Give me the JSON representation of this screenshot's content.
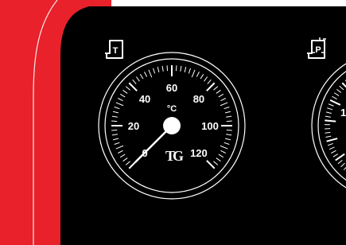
{
  "colors": {
    "background": "#ffffff",
    "panel_red": "#e8212b",
    "face_black": "#000000",
    "marking_white": "#ffffff"
  },
  "thermometer": {
    "icon": "thermometer-sensor-icon",
    "icon_letter": "T",
    "unit": "°C",
    "scale_labels": [
      "0",
      "20",
      "40",
      "60",
      "80",
      "100",
      "120"
    ],
    "scale_min": 0,
    "scale_max": 120,
    "pointer_value": 0,
    "brand_mark": "TG"
  },
  "pressure_gauge": {
    "icon": "pressure-sensor-icon",
    "icon_letter": "P",
    "visible_label_fragment": "1"
  }
}
